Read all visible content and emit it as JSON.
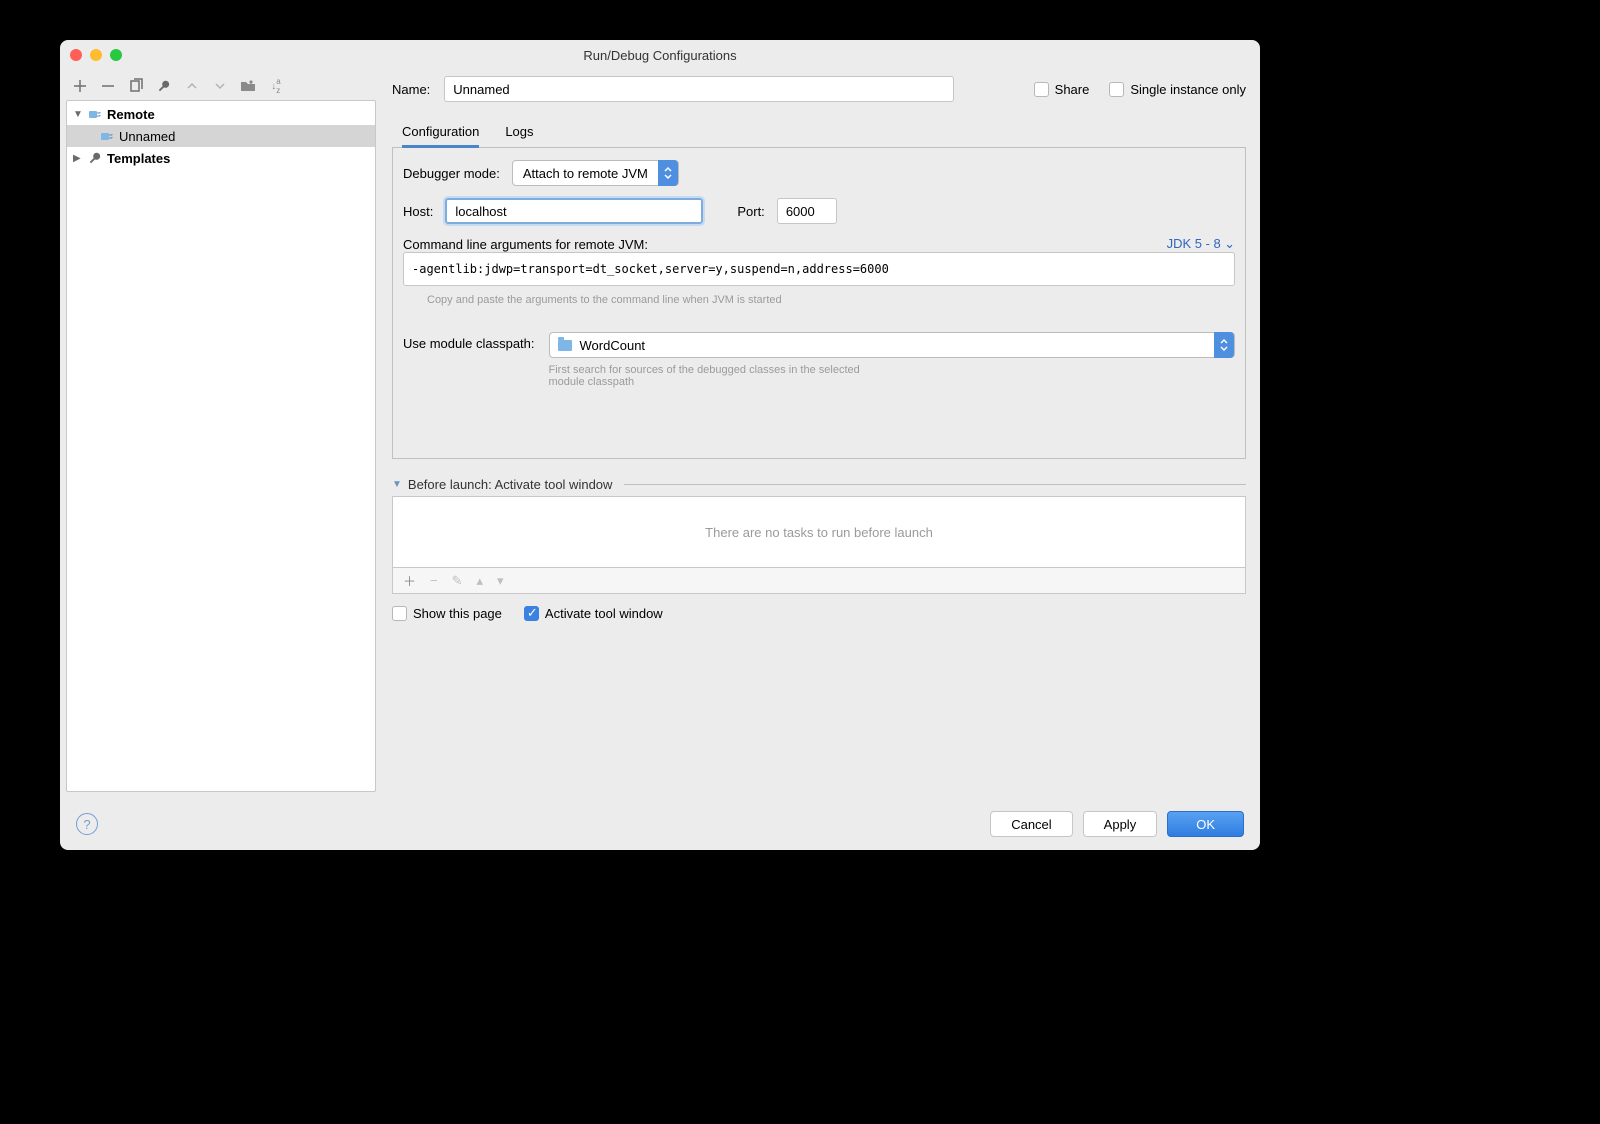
{
  "window": {
    "title": "Run/Debug Configurations"
  },
  "sidebar": {
    "items": [
      {
        "label": "Remote",
        "expanded": true
      },
      {
        "label": "Unnamed",
        "selected": true
      },
      {
        "label": "Templates"
      }
    ]
  },
  "form": {
    "name_label": "Name:",
    "name_value": "Unnamed",
    "share_label": "Share",
    "single_instance_label": "Single instance only"
  },
  "tabs": [
    {
      "label": "Configuration",
      "active": true
    },
    {
      "label": "Logs"
    }
  ],
  "config": {
    "debugger_mode_label": "Debugger mode:",
    "debugger_mode_value": "Attach to remote JVM",
    "host_label": "Host:",
    "host_value": "localhost",
    "port_label": "Port:",
    "port_value": "6000",
    "cmd_label": "Command line arguments for remote JVM:",
    "jdk_label": "JDK 5 - 8",
    "cmd_value": "-agentlib:jdwp=transport=dt_socket,server=y,suspend=n,address=6000",
    "cmd_hint": "Copy and paste the arguments to the command line when JVM is started",
    "module_label": "Use module classpath:",
    "module_value": "WordCount",
    "module_hint": "First search for sources of the debugged classes in the selected module classpath"
  },
  "before_launch": {
    "header": "Before launch: Activate tool window",
    "empty_text": "There are no tasks to run before launch",
    "show_page_label": "Show this page",
    "activate_label": "Activate tool window"
  },
  "footer": {
    "cancel": "Cancel",
    "apply": "Apply",
    "ok": "OK"
  }
}
